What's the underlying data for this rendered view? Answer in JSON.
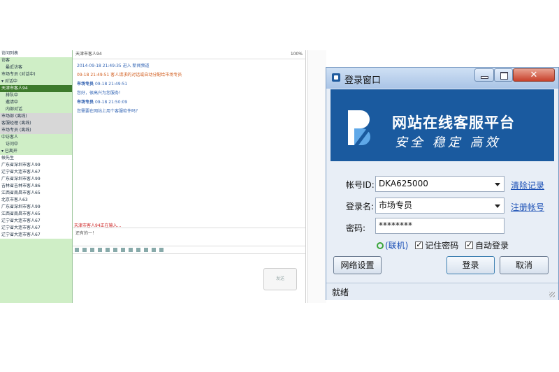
{
  "background_app": {
    "tree": [
      {
        "text": "访问列表",
        "style": "w"
      },
      {
        "text": "访客",
        "style": ""
      },
      {
        "text": "最近访客",
        "style": "sub"
      },
      {
        "text": "市场专员 (对话中)",
        "style": ""
      },
      {
        "text": "▾ 对话中",
        "style": ""
      },
      {
        "text": "天津市客人94",
        "style": "sel"
      },
      {
        "text": "排队中",
        "style": "sub"
      },
      {
        "text": "邀请中",
        "style": "sub"
      },
      {
        "text": "内部对话",
        "style": "sub"
      },
      {
        "text": "市场部 (离线)",
        "style": "g"
      },
      {
        "text": "客服经理 (离线)",
        "style": "g"
      },
      {
        "text": "市场专员 (离线)",
        "style": "g"
      },
      {
        "text": "中访客人",
        "style": ""
      },
      {
        "text": "访问中",
        "style": "sub"
      },
      {
        "text": "▾ 已离开",
        "style": ""
      },
      {
        "text": "候先生",
        "style": "w"
      },
      {
        "text": "广东省深圳市客人99",
        "style": "w"
      },
      {
        "text": "辽宁省大连市客人67",
        "style": "w"
      },
      {
        "text": "广东省深圳市客人99",
        "style": "w"
      },
      {
        "text": "吉林省吉林市客人86",
        "style": "w"
      },
      {
        "text": "江西省南昌市客人65",
        "style": "w"
      },
      {
        "text": "北京市客人63",
        "style": "w"
      },
      {
        "text": "广东省深圳市客人99",
        "style": "w"
      },
      {
        "text": "江西省南昌市客人65",
        "style": "w"
      },
      {
        "text": "辽宁省大连市客人67",
        "style": "w"
      },
      {
        "text": "辽宁省大连市客人67",
        "style": "w"
      },
      {
        "text": "辽宁省大连市客人67",
        "style": "w"
      }
    ],
    "chat_title": "天津市客人94",
    "zoom": "100%",
    "messages": [
      {
        "who": "",
        "text": "2014-09-18 21:49:35 进入 新闻频道",
        "warn": false
      },
      {
        "who": "",
        "text": "09-18 21:49:51 客人请求的对话或自动分配给市场专员",
        "warn": true
      },
      {
        "who": "市场专员",
        "text": "09-18 21:49:51",
        "warn": false
      },
      {
        "who": "",
        "text": "您好，很高兴为您服务！",
        "warn": false
      },
      {
        "who": "市场专员",
        "text": "09-18 21:50:09",
        "warn": false
      },
      {
        "who": "",
        "text": "您需要在网站上用个客服软件吗？",
        "warn": false
      }
    ],
    "notice": "天津市客人94正在输入...",
    "input_text": "还有的一！",
    "send_label": "发送"
  },
  "dialog": {
    "title": "登录窗口",
    "banner_title": "网站在线客服平台",
    "banner_slogan": "安全 稳定 高效",
    "account_label": "帐号ID:",
    "account_value": "DKA625000",
    "clear_history": "清除记录",
    "username_label": "登录名:",
    "username_value": "市场专员",
    "register": "注册帐号",
    "password_label": "密码:",
    "password_value": "********",
    "online_label": "(联机)",
    "remember_label": "记住密码",
    "autologin_label": "自动登录",
    "remember_checked": true,
    "autologin_checked": true,
    "net_settings_label": "网络设置",
    "login_label": "登录",
    "cancel_label": "取消",
    "status": "就绪",
    "colors": {
      "banner": "#1a5a9f",
      "close_button": "#c8412b",
      "link": "#1a4fb5"
    }
  }
}
